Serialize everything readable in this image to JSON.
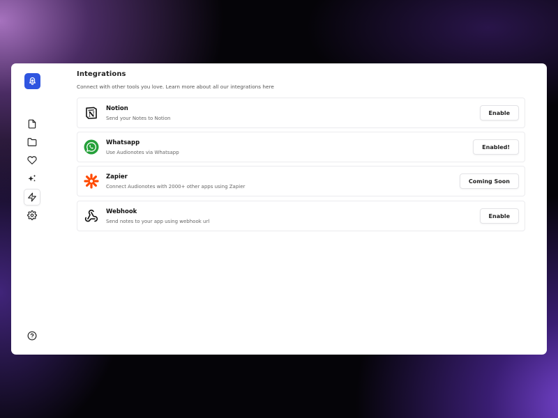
{
  "sidebar": {
    "logo_icon": "bell-icon",
    "items": [
      {
        "name": "notes",
        "icon": "file-icon",
        "active": false
      },
      {
        "name": "folders",
        "icon": "folder-icon",
        "active": false
      },
      {
        "name": "favorites",
        "icon": "heart-icon",
        "active": false
      },
      {
        "name": "ai",
        "icon": "sparkles-icon",
        "active": false
      },
      {
        "name": "integrations",
        "icon": "lightning-icon",
        "active": true
      },
      {
        "name": "settings",
        "icon": "gear-icon",
        "active": false
      }
    ],
    "help_icon": "help-circle-icon"
  },
  "main": {
    "title": "Integrations",
    "subtitle": "Connect with other tools you love. Learn more about all our integrations here",
    "integrations": [
      {
        "name": "Notion",
        "description": "Send your Notes to Notion",
        "button": "Enable",
        "icon": "notion-icon"
      },
      {
        "name": "Whatsapp",
        "description": "Use Audionotes via Whatsapp",
        "button": "Enabled!",
        "icon": "whatsapp-icon"
      },
      {
        "name": "Zapier",
        "description": "Connect Audionotes with 2000+ other apps using Zapier",
        "button": "Coming Soon",
        "icon": "zapier-icon"
      },
      {
        "name": "Webhook",
        "description": "Send notes to your app using webhook url",
        "button": "Enable",
        "icon": "webhook-icon"
      }
    ]
  },
  "colors": {
    "brand": "#2f55e0",
    "whatsapp": "#25a03a",
    "zapier": "#ff4a00"
  }
}
